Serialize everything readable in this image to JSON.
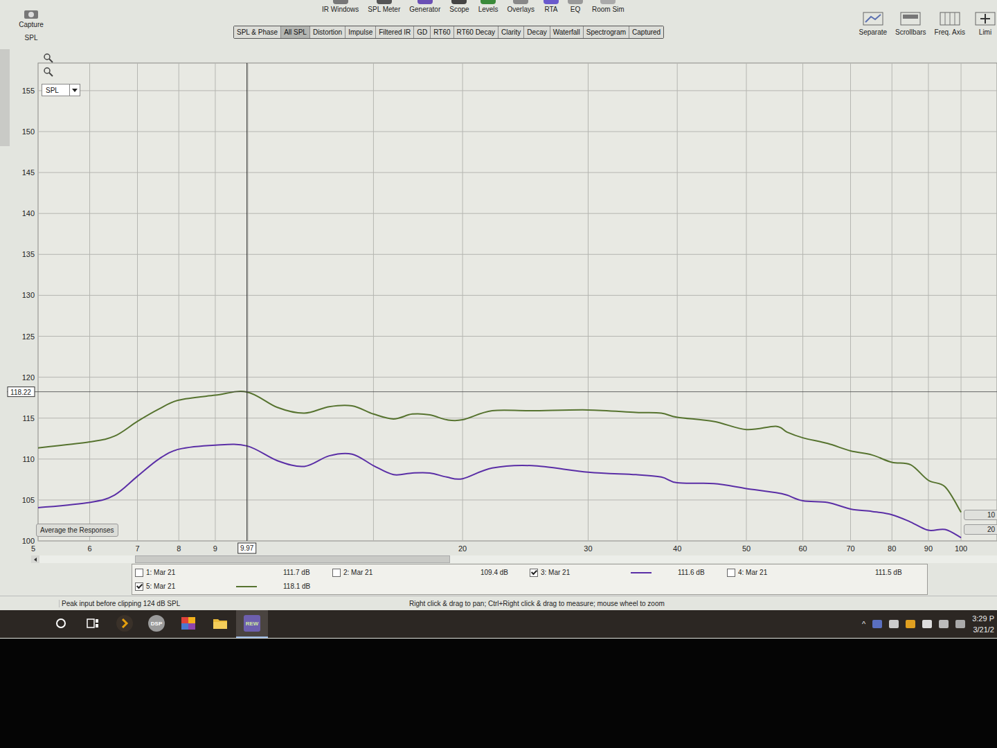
{
  "toolbar": {
    "capture": {
      "label": "Capture"
    },
    "tools": [
      "IR Windows",
      "SPL Meter",
      "Generator",
      "Scope",
      "Levels",
      "Overlays",
      "RTA",
      "EQ",
      "Room Sim"
    ],
    "view_tools": [
      "Separate",
      "Scrollbars",
      "Freq. Axis",
      "Limi"
    ]
  },
  "tabs": [
    {
      "label": "SPL & Phase",
      "selected": false
    },
    {
      "label": "All SPL",
      "selected": true
    },
    {
      "label": "Distortion",
      "selected": false
    },
    {
      "label": "Impulse",
      "selected": false
    },
    {
      "label": "Filtered IR",
      "selected": false
    },
    {
      "label": "GD",
      "selected": false
    },
    {
      "label": "RT60",
      "selected": false
    },
    {
      "label": "RT60 Decay",
      "selected": false
    },
    {
      "label": "Clarity",
      "selected": false
    },
    {
      "label": "Decay",
      "selected": false
    },
    {
      "label": "Waterfall",
      "selected": false
    },
    {
      "label": "Spectrogram",
      "selected": false
    },
    {
      "label": "Captured",
      "selected": false
    }
  ],
  "chart": {
    "axis_label": "SPL",
    "dropdown": "SPL",
    "y_ticks": [
      "155",
      "150",
      "145",
      "140",
      "135",
      "130",
      "125",
      "120",
      "115",
      "110",
      "105",
      "100"
    ],
    "x_ticks": [
      "5",
      "6",
      "7",
      "8",
      "9",
      "20",
      "30",
      "40",
      "50",
      "60",
      "70",
      "80",
      "90",
      "100"
    ],
    "cursor": {
      "x": "9.97",
      "y": "118.22"
    },
    "frequencies": [
      5,
      6,
      6.5,
      7,
      7.5,
      8,
      9,
      9.97,
      11,
      12,
      13,
      14,
      15,
      16,
      17,
      18,
      19,
      20,
      22,
      25,
      30,
      35,
      38,
      40,
      45,
      50,
      55,
      57,
      60,
      65,
      70,
      75,
      80,
      85,
      90,
      95,
      100
    ],
    "series": [
      {
        "color": "#56732f",
        "values": [
          111.3,
          112.1,
          112.8,
          114.6,
          116.1,
          117.2,
          117.8,
          118.2,
          116.3,
          115.6,
          116.4,
          116.5,
          115.5,
          114.9,
          115.5,
          115.4,
          114.8,
          114.8,
          115.9,
          115.9,
          116.0,
          115.7,
          115.6,
          115.1,
          114.6,
          113.6,
          114.0,
          113.3,
          112.6,
          111.9,
          111.0,
          110.5,
          109.6,
          109.3,
          107.4,
          106.6,
          103.5
        ]
      },
      {
        "color": "#5a2ea6",
        "values": [
          104.0,
          104.7,
          105.6,
          107.9,
          110.0,
          111.2,
          111.7,
          111.6,
          109.8,
          109.1,
          110.4,
          110.6,
          109.2,
          108.1,
          108.3,
          108.3,
          107.8,
          107.6,
          108.9,
          109.2,
          108.4,
          108.1,
          107.8,
          107.1,
          107.0,
          106.4,
          105.9,
          105.6,
          104.9,
          104.7,
          103.9,
          103.6,
          103.2,
          102.3,
          101.3,
          101.4,
          100.4
        ]
      }
    ],
    "average_button": "Average the Responses",
    "side_labels": [
      "10",
      "20"
    ]
  },
  "legend": [
    {
      "label": "1: Mar 21",
      "checked": false,
      "reading": "111.7 dB"
    },
    {
      "label": "2: Mar 21",
      "checked": false,
      "reading": "109.4 dB"
    },
    {
      "label": "3: Mar 21",
      "checked": true,
      "reading": "111.6 dB",
      "color": "#5a2ea6"
    },
    {
      "label": "4: Mar 21",
      "checked": false,
      "reading": "111.5 dB"
    },
    {
      "label": "5: Mar 21",
      "checked": true,
      "reading": "118.1 dB",
      "color": "#56732f"
    }
  ],
  "status_bar": {
    "peak": "Peak input before clipping 124 dB SPL",
    "hint": "Right click & drag to pan; Ctrl+Right click & drag to measure; mouse wheel to zoom"
  },
  "taskbar": {
    "apps": [
      {
        "kind": "search",
        "selected": false
      },
      {
        "kind": "taskview",
        "selected": false
      },
      {
        "kind": "plex",
        "selected": false
      },
      {
        "kind": "dsp",
        "label": "DSP",
        "selected": false
      },
      {
        "kind": "gallery",
        "selected": false
      },
      {
        "kind": "folder",
        "selected": false
      },
      {
        "kind": "rew",
        "label": "REW",
        "selected": true
      }
    ],
    "tray": {
      "chevron": "^",
      "time": "3:29 P",
      "date": "3/21/2"
    }
  }
}
